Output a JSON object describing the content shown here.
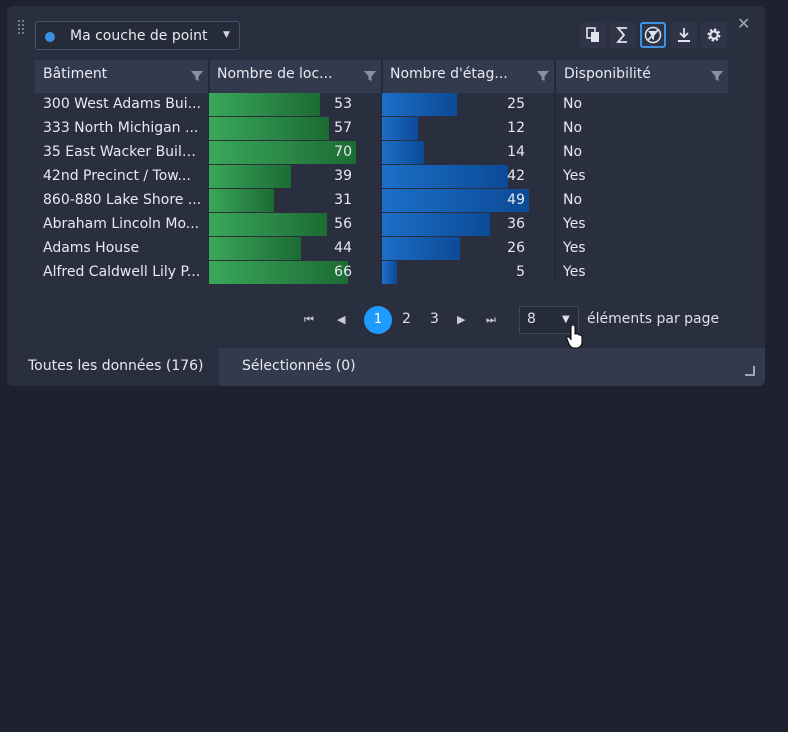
{
  "layer_selector": {
    "label": "Ma couche de point",
    "dot_color": "#3b8fe0"
  },
  "toolbar": {
    "icons": [
      "copy-icon",
      "sum-icon",
      "filter-off-icon",
      "download-icon",
      "settings-icon"
    ],
    "close_glyph": "✕"
  },
  "table": {
    "columns": [
      {
        "label": "Bâtiment"
      },
      {
        "label": "Nombre de loc..."
      },
      {
        "label": "Nombre d'étag..."
      },
      {
        "label": "Disponibilité"
      }
    ],
    "rows": [
      {
        "name": "300 West Adams Bui...",
        "locataires": 53,
        "etages": 25,
        "dispo": "No"
      },
      {
        "name": "333 North Michigan ...",
        "locataires": 57,
        "etages": 12,
        "dispo": "No"
      },
      {
        "name": "35 East Wacker Build...",
        "locataires": 70,
        "etages": 14,
        "dispo": "No"
      },
      {
        "name": "42nd Precinct / Tow...",
        "locataires": 39,
        "etages": 42,
        "dispo": "Yes"
      },
      {
        "name": "860-880 Lake Shore ...",
        "locataires": 31,
        "etages": 49,
        "dispo": "No"
      },
      {
        "name": "Abraham Lincoln Mo...",
        "locataires": 56,
        "etages": 36,
        "dispo": "Yes"
      },
      {
        "name": "Adams House",
        "locataires": 44,
        "etages": 26,
        "dispo": "Yes"
      },
      {
        "name": "Alfred Caldwell Lily P...",
        "locataires": 66,
        "etages": 5,
        "dispo": "Yes"
      }
    ],
    "bar_max": {
      "locataires": 70,
      "etages": 49
    },
    "colors": {
      "green": "#3aa85a",
      "green_dark": "#1c6b34",
      "blue": "#1d6fc8",
      "blue_dark": "#0b4a96"
    }
  },
  "pagination": {
    "pages": [
      "1",
      "2",
      "3"
    ],
    "current": "1",
    "per_page": "8",
    "per_page_label": "éléments par page"
  },
  "tabs": [
    {
      "label": "Toutes les données (176)"
    },
    {
      "label": "Sélectionnés (0)"
    }
  ]
}
